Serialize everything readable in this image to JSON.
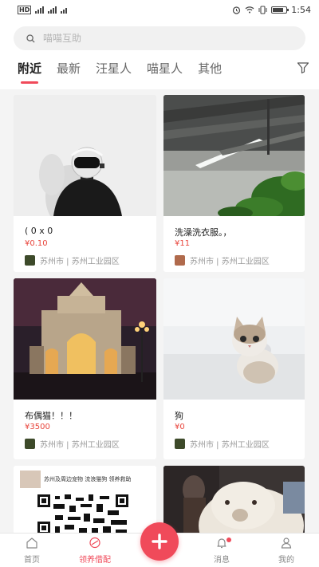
{
  "status_bar": {
    "time": "1:54",
    "carrier": "HD"
  },
  "search": {
    "placeholder": "喵喵互助"
  },
  "tabs": [
    {
      "label": "附近",
      "active": true
    },
    {
      "label": "最新",
      "active": false
    },
    {
      "label": "汪星人",
      "active": false
    },
    {
      "label": "喵星人",
      "active": false
    },
    {
      "label": "其他",
      "active": false
    }
  ],
  "posts": [
    {
      "title": "( 0 x 0",
      "price": "¥0.10",
      "location": "苏州市 | 苏州工业园区"
    },
    {
      "title": "洗澡洗衣服。，",
      "price": "¥11",
      "location": "苏州市 | 苏州工业园区"
    },
    {
      "title": "布偶猫！！！",
      "price": "¥3500",
      "location": "苏州市 | 苏州工业园区"
    },
    {
      "title": "狗",
      "price": "¥0",
      "location": "苏州市 | 苏州工业园区"
    },
    {
      "poster_text": "苏州及周边宠物 流浪猫狗 领养救助"
    }
  ],
  "bottom_nav": [
    {
      "label": "首页",
      "active": false
    },
    {
      "label": "领养借配",
      "active": true
    },
    {
      "label": "消息",
      "active": false
    },
    {
      "label": "我的",
      "active": false
    }
  ],
  "colors": {
    "accent": "#f04a5a",
    "price": "#e8453c"
  }
}
